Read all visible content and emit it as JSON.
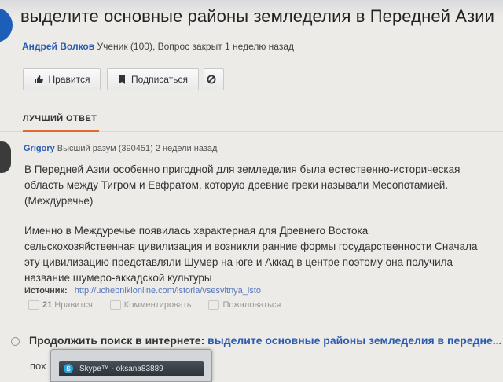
{
  "question": {
    "title": "выделите основные районы земледелия в Передней Азии",
    "author": "Андрей Волков",
    "author_info": "Ученик (100), Вопрос закрыт 1 неделю назад"
  },
  "toolbar": {
    "like_label": "Нравится",
    "subscribe_label": "Подписаться"
  },
  "best_answer": {
    "header": "ЛУЧШИЙ ОТВЕТ",
    "author": "Grigory",
    "author_info": "Высший разум (390451) 2 недели назад",
    "paragraph1": "В Передней Азии особенно пригодной для земледелия была естественно-историческая область между Тигром и Евфратом, которую древние греки называли Месопотамией. (Междуречье)",
    "paragraph2": "Именно в Междуречье появилась характерная для Древнего Востока сельскохозяйственная цивилизация и возникли ранние формы государственности Сначала эту цивилизацию представляли Шумер на юге и Аккад в центре поэтому она получила название шумеро-аккадской культуры",
    "source_label": "Источник:",
    "source_link": "http://uchebnikionline.com/istoria/vsesvitnya_isto",
    "like_count": "21",
    "like_label": "Нравится",
    "comment_label": "Комментировать",
    "report_label": "Пожаловаться"
  },
  "search": {
    "label": "Продолжить поиск в интернете:",
    "query": "выделите основные районы земледелия в передне..."
  },
  "partial_text": "пох",
  "skype_taskbar": {
    "label": "Skype™ - oksana83889"
  },
  "colors": {
    "accent": "#e06a2c",
    "link": "#2a5bb0",
    "avatar": "#1d5fb8"
  }
}
